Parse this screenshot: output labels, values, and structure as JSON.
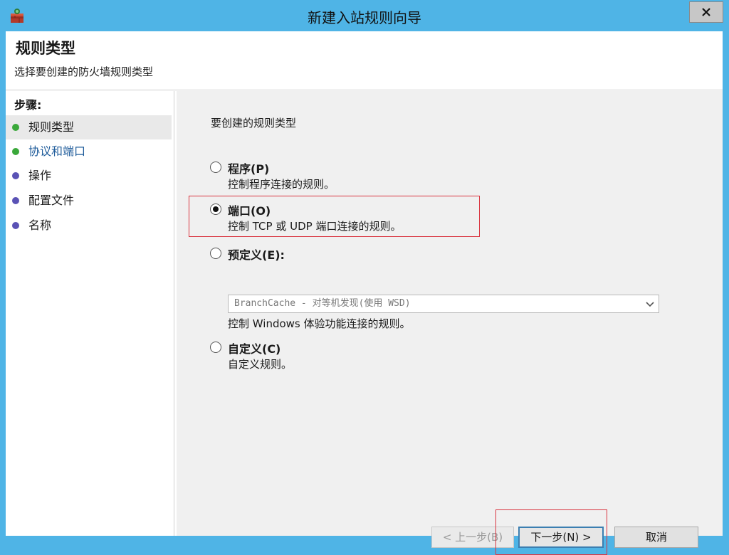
{
  "window": {
    "title": "新建入站规则向导",
    "close_label": "✕"
  },
  "header": {
    "title": "规则类型",
    "subtitle": "选择要创建的防火墙规则类型"
  },
  "steps": {
    "heading": "步骤:",
    "items": [
      {
        "label": "规则类型",
        "color": "#3aa83a"
      },
      {
        "label": "协议和端口",
        "color": "#3aa83a"
      },
      {
        "label": "操作",
        "color": "#5a52b5"
      },
      {
        "label": "配置文件",
        "color": "#5a52b5"
      },
      {
        "label": "名称",
        "color": "#5a52b5"
      }
    ]
  },
  "content": {
    "question": "要创建的规则类型",
    "options": [
      {
        "label": "程序(P)",
        "desc": "控制程序连接的规则。",
        "checked": false
      },
      {
        "label": "端口(O)",
        "desc": "控制 TCP 或 UDP 端口连接的规则。",
        "checked": true
      },
      {
        "label": "预定义(E):",
        "desc": "控制 Windows 体验功能连接的规则。",
        "checked": false
      },
      {
        "label": "自定义(C)",
        "desc": "自定义规则。",
        "checked": false
      }
    ],
    "predefined_select": "BranchCache - 对等机发现(使用 WSD)"
  },
  "buttons": {
    "back": "< 上一步(B)",
    "next": "下一步(N) >",
    "cancel": "取消"
  },
  "colors": {
    "titlebar": "#4fb4e6",
    "highlight": "#d9343f",
    "link": "#1e5b9a"
  }
}
